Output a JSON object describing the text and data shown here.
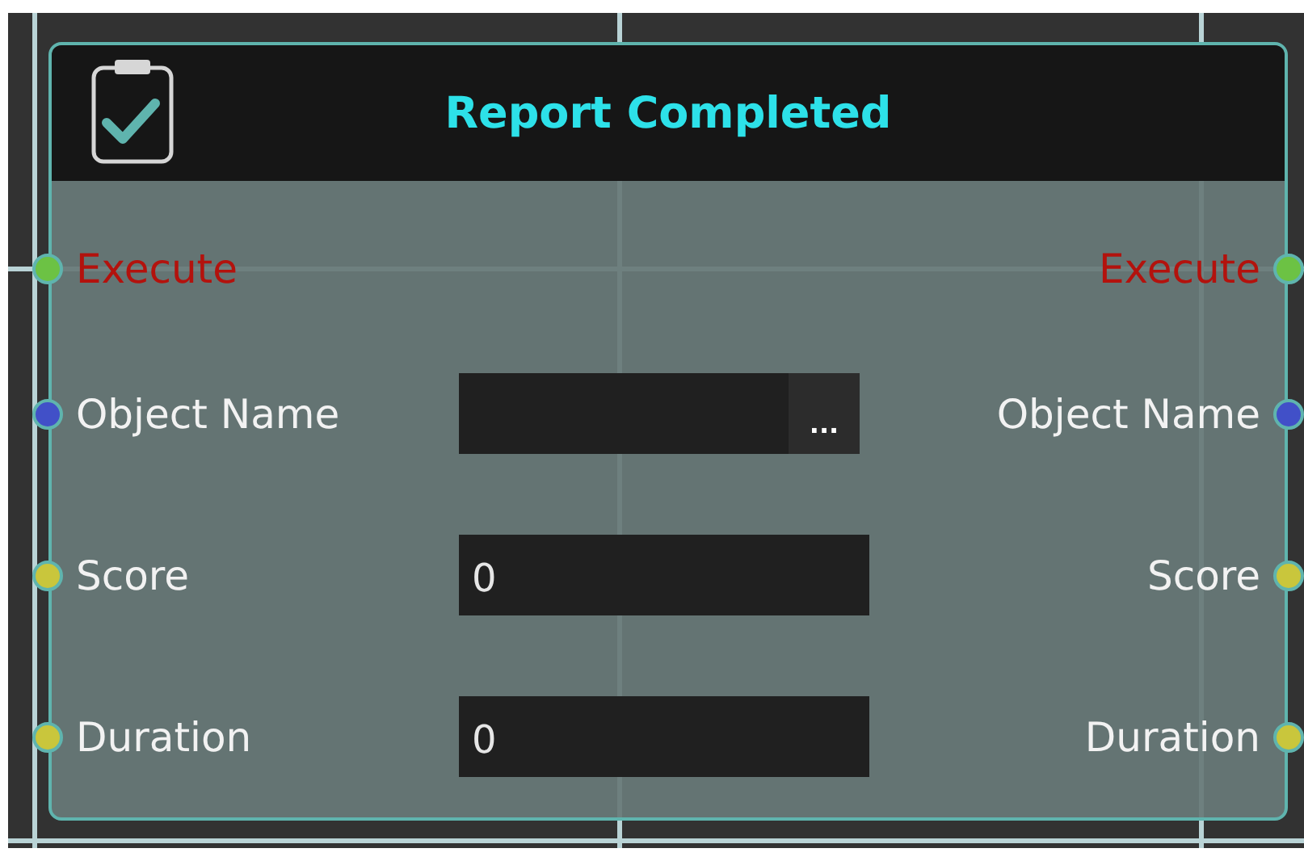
{
  "node": {
    "title": "Report Completed",
    "rows": [
      {
        "kind": "exec",
        "input": {
          "label": "Execute",
          "color": "#6cc244"
        },
        "output": {
          "label": "Execute",
          "color": "#6cc244"
        }
      },
      {
        "kind": "data",
        "input": {
          "label": "Object Name",
          "color": "#4150c8"
        },
        "field": {
          "kind": "picker",
          "button": "..."
        },
        "output": {
          "label": "Object Name",
          "color": "#4150c8"
        }
      },
      {
        "kind": "data",
        "input": {
          "label": "Score",
          "color": "#c9c63c"
        },
        "field": {
          "kind": "number",
          "value": "0"
        },
        "output": {
          "label": "Score",
          "color": "#c9c63c"
        }
      },
      {
        "kind": "data",
        "input": {
          "label": "Duration",
          "color": "#c9c63c"
        },
        "field": {
          "kind": "number",
          "value": "0"
        },
        "output": {
          "label": "Duration",
          "color": "#c9c63c"
        }
      }
    ]
  }
}
